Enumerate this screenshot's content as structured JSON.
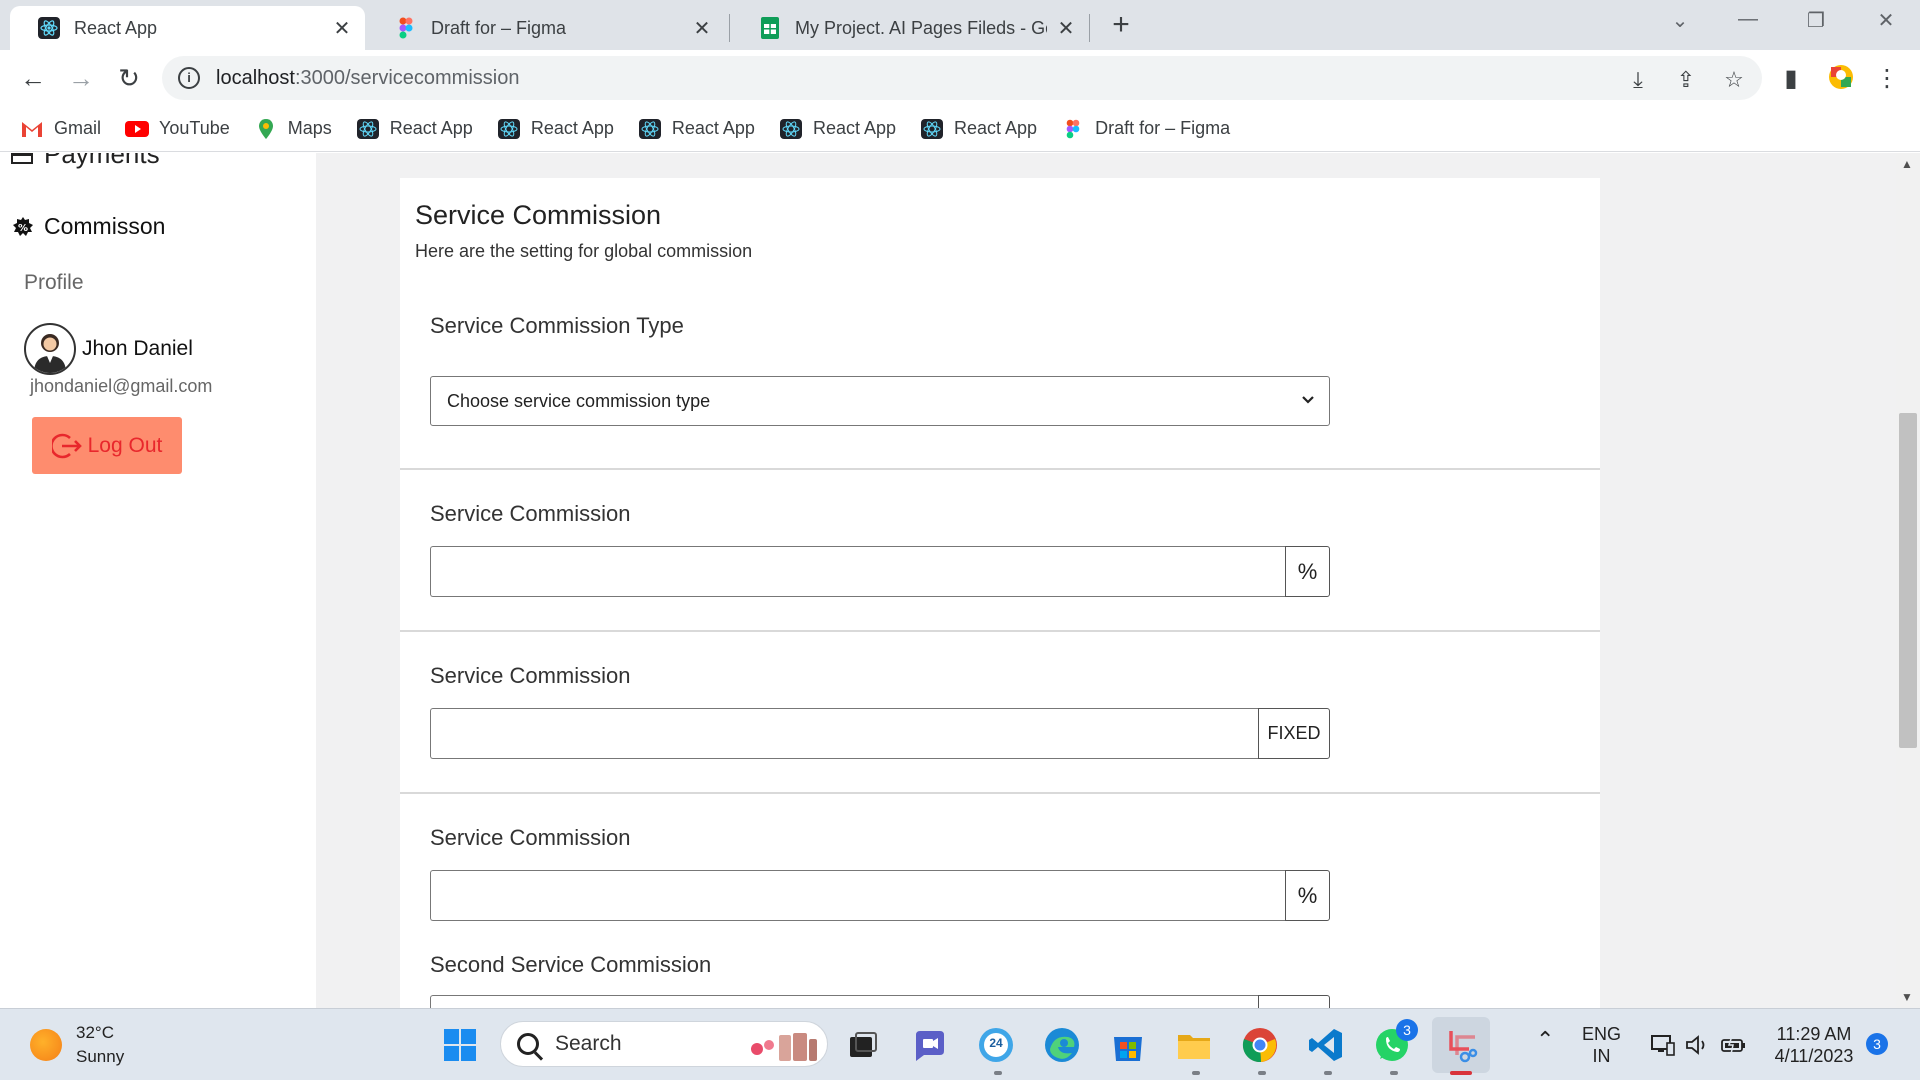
{
  "browser": {
    "tabs": [
      {
        "title": "React App",
        "active": true
      },
      {
        "title": "Draft for – Figma",
        "active": false
      },
      {
        "title": "My Project. AI Pages Fileds - Goo",
        "active": false
      }
    ],
    "url_host": "localhost",
    "url_path": ":3000/servicecommission",
    "bookmarks": [
      "Gmail",
      "YouTube",
      "Maps",
      "React App",
      "React App",
      "React App",
      "React App",
      "React App",
      "Draft for – Figma"
    ]
  },
  "sidebar": {
    "payments_label": "Payments",
    "commission_label": "Commisson",
    "profile_label": "Profile",
    "user_name": "Jhon Daniel",
    "user_email": "jhondaniel@gmail.com",
    "logout_label": "Log Out"
  },
  "card": {
    "title": "Service Commission",
    "subtitle": "Here are the setting for global commission",
    "type_label": "Service Commission Type",
    "type_placeholder": "Choose service commission type",
    "fields": [
      {
        "label": "Service Commission",
        "addon": "%"
      },
      {
        "label": "Service Commission",
        "addon": "FIXED"
      },
      {
        "label": "Service Commission",
        "addon": "%"
      }
    ],
    "second_label": "Second Service Commission"
  },
  "taskbar": {
    "temp": "32°C",
    "condition": "Sunny",
    "search_label": "Search",
    "lang_top": "ENG",
    "lang_bottom": "IN",
    "time": "11:29 AM",
    "date": "4/11/2023",
    "whatsapp_badge": "3",
    "notif_badge": "3",
    "calendar_day": "24"
  },
  "colors": {
    "logout_bg": "#fe8c6e",
    "logout_text": "#e8272c",
    "main_bg": "#f1f1f2",
    "taskbar_bg": "#dfe6ee"
  }
}
